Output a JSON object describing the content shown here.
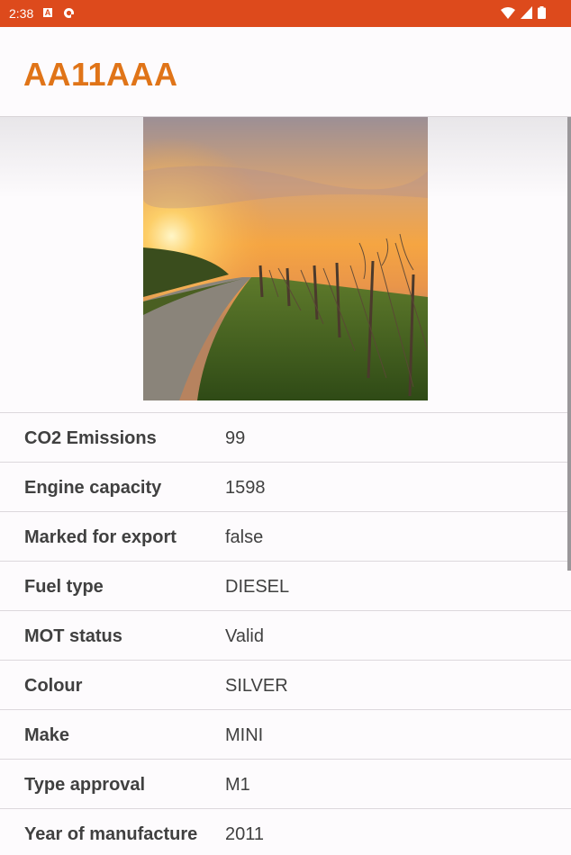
{
  "status_bar": {
    "time": "2:38",
    "notif_letter": "A",
    "icons": [
      "a-notification-icon",
      "sync-notification-icon",
      "wifi-icon",
      "cell-signal-icon",
      "battery-icon"
    ],
    "background_color": "#dd4a1c"
  },
  "app_bar": {
    "title": "AA11AAA",
    "title_color": "#e07418"
  },
  "vehicle_image": {
    "subject": "sunset over vineyard path"
  },
  "details": [
    {
      "label": "CO2 Emissions",
      "value": "99"
    },
    {
      "label": "Engine capacity",
      "value": "1598"
    },
    {
      "label": "Marked for export",
      "value": "false"
    },
    {
      "label": "Fuel type",
      "value": "DIESEL"
    },
    {
      "label": "MOT status",
      "value": "Valid"
    },
    {
      "label": "Colour",
      "value": "SILVER"
    },
    {
      "label": "Make",
      "value": "MINI"
    },
    {
      "label": "Type approval",
      "value": "M1"
    },
    {
      "label": "Year of manufacture",
      "value": "2011"
    }
  ]
}
